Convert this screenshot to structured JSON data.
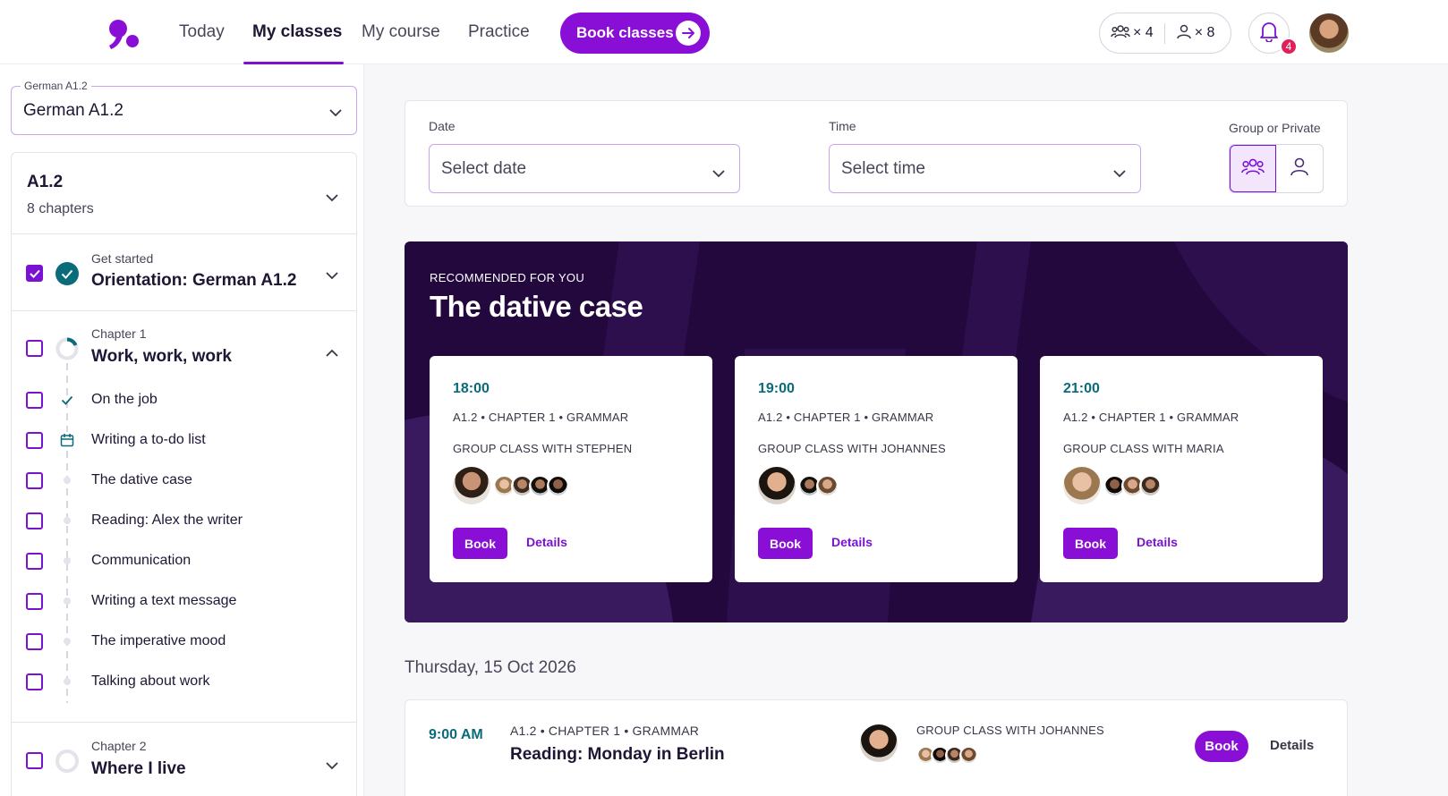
{
  "nav": {
    "items": [
      "Today",
      "My classes",
      "My course",
      "Practice"
    ],
    "active": "My classes",
    "book_classes_label": "Book classes",
    "group_credits": "× 4",
    "private_credits": "× 8",
    "notification_count": "4"
  },
  "sidebar": {
    "course_select_label": "German A1.2",
    "course_select_value": "German A1.2",
    "level": {
      "title": "A1.2",
      "subtitle": "8 chapters"
    },
    "orientation": {
      "kicker": "Get started",
      "title": "Orientation: German A1.2",
      "checked": true
    },
    "chapter1": {
      "kicker": "Chapter 1",
      "title": "Work, work, work",
      "lessons": [
        "On the job",
        "Writing a to-do list",
        "The dative case",
        "Reading: Alex the writer",
        "Communication",
        "Writing a text message",
        "The imperative mood",
        "Talking about work"
      ]
    },
    "chapter2": {
      "kicker": "Chapter 2",
      "title": "Where I live"
    }
  },
  "filters": {
    "date_label": "Date",
    "date_placeholder": "Select date",
    "time_label": "Time",
    "time_placeholder": "Select time",
    "mode_label": "Group or Private",
    "selected_mode": "group"
  },
  "recommended": {
    "kicker": "RECOMMENDED FOR YOU",
    "title": "The dative case",
    "book_label": "Book",
    "details_label": "Details",
    "cards": [
      {
        "time": "18:00",
        "meta": "A1.2 • CHAPTER 1 • GRAMMAR",
        "teacher": "GROUP CLASS WITH STEPHEN"
      },
      {
        "time": "19:00",
        "meta": "A1.2 • CHAPTER 1 • GRAMMAR",
        "teacher": "GROUP CLASS WITH JOHANNES"
      },
      {
        "time": "21:00",
        "meta": "A1.2 • CHAPTER 1 • GRAMMAR",
        "teacher": "GROUP CLASS WITH MARIA"
      }
    ]
  },
  "schedule": {
    "day_heading": "Thursday, 15 Oct 2026",
    "rows": [
      {
        "time": "9:00 AM",
        "meta": "A1.2  •  CHAPTER 1  •  GRAMMAR",
        "title": "Reading: Monday in Berlin",
        "teacher": "GROUP CLASS WITH JOHANNES",
        "book_label": "Book",
        "details_label": "Details"
      }
    ]
  },
  "colors": {
    "accent": "#8a0fd6",
    "banner": "#22083d",
    "time_text": "#0a6b7a",
    "badge": "#e0205a"
  }
}
